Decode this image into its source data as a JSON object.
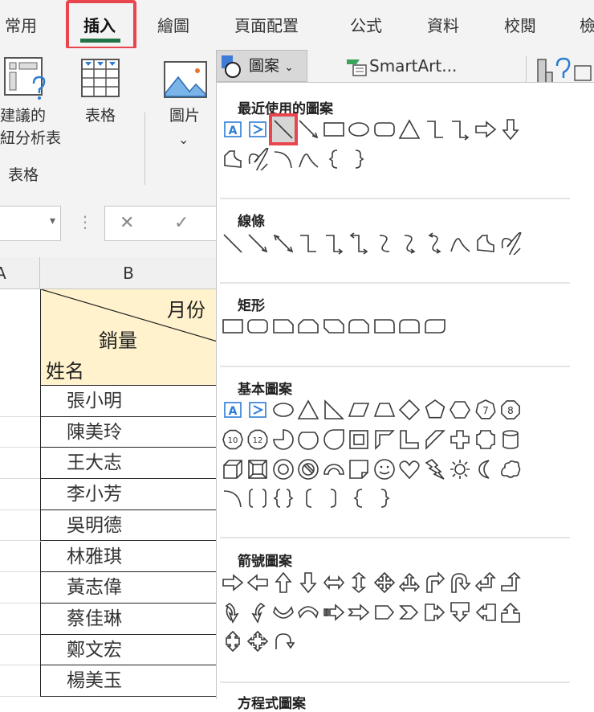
{
  "tabs": [
    "常用",
    "插入",
    "繪圖",
    "頁面配置",
    "公式",
    "資料",
    "校閱",
    "檢"
  ],
  "ribbon": {
    "pivot_label_1": "建議的",
    "pivot_label_2": "紐分析表",
    "table_label": "表格",
    "group_label": "表格",
    "picture_label": "圖片",
    "picture_chevron": "⌄",
    "shapes_label": "圖案",
    "shapes_chevron": "⌄",
    "smartart_label": "SmartArt..."
  },
  "formula_bar": {
    "name_box_arrow": "▾",
    "dots": "⋮",
    "cancel": "✕",
    "enter": "✓"
  },
  "sheet": {
    "col_a": "A",
    "col_b": "B",
    "header": {
      "month": "月份",
      "sales": "銷量",
      "name": "姓名"
    },
    "names": [
      "張小明",
      "陳美玲",
      "王大志",
      "李小芳",
      "吳明德",
      "林雅琪",
      "黃志偉",
      "蔡佳琳",
      "鄭文宏",
      "楊美玉"
    ]
  },
  "menu": {
    "sections": [
      {
        "title": "最近使用的圖案",
        "rows": [
          [
            "textbox",
            "vtextbox",
            "line",
            "arrow-line",
            "rect",
            "oval",
            "rounded-rect",
            "triangle",
            "elbow",
            "elbow-arrow",
            "right-arrow",
            "down-arrow"
          ],
          [
            "freeform",
            "scribble",
            "arc",
            "curve",
            "left-brace",
            "right-brace"
          ]
        ]
      },
      {
        "title": "線條",
        "rows": [
          [
            "line",
            "arrow-line",
            "double-arrow-line",
            "elbow",
            "elbow-arrow",
            "elbow-double-arrow",
            "curved-connector",
            "curved-arrow",
            "curved-double-arrow",
            "curve",
            "freeform",
            "scribble"
          ]
        ]
      },
      {
        "title": "矩形",
        "rows": [
          [
            "rect",
            "rounded-rect",
            "snip1",
            "snip2same",
            "snip2diag",
            "sniprounded",
            "round1",
            "round2same",
            "round2diag"
          ]
        ]
      },
      {
        "title": "基本圖案",
        "rows": [
          [
            "textbox",
            "vtextbox",
            "oval",
            "triangle",
            "right-triangle",
            "parallelogram",
            "trapezoid",
            "diamond",
            "pentagon",
            "hexagon",
            "heptagon",
            "octagon"
          ],
          [
            "decagon",
            "dodecagon",
            "pie",
            "chord",
            "teardrop",
            "frame",
            "half-frame",
            "l-shape",
            "diagonal-stripe",
            "cross",
            "plaque",
            "can"
          ],
          [
            "cube",
            "bevel",
            "donut",
            "no-symbol",
            "block-arc",
            "folded-corner",
            "smiley",
            "heart",
            "lightning",
            "sun",
            "moon",
            "cloud"
          ],
          [
            "arc",
            "double-bracket",
            "double-brace",
            "left-bracket",
            "right-bracket",
            "left-brace",
            "right-brace"
          ]
        ]
      },
      {
        "title": "箭號圖案",
        "rows": [
          [
            "right-arrow",
            "left-arrow",
            "up-arrow",
            "down-arrow",
            "left-right-arrow",
            "up-down-arrow",
            "quad-arrow",
            "left-right-up-arrow",
            "bent-arrow",
            "u-turn-arrow",
            "left-up-arrow",
            "bent-up-arrow"
          ],
          [
            "curved-right-arrow",
            "curved-left-arrow",
            "curved-up-arrow",
            "curved-down-arrow",
            "striped-right-arrow",
            "notched-right-arrow",
            "pentagon-arrow",
            "chevron",
            "right-callout",
            "down-callout",
            "left-callout",
            "up-callout"
          ],
          [
            "up-down-callout",
            "quad-callout",
            "circular-arrow"
          ]
        ]
      },
      {
        "title": "方程式圖案",
        "rows": []
      }
    ],
    "selected": "line",
    "accent": "#e8454e"
  }
}
